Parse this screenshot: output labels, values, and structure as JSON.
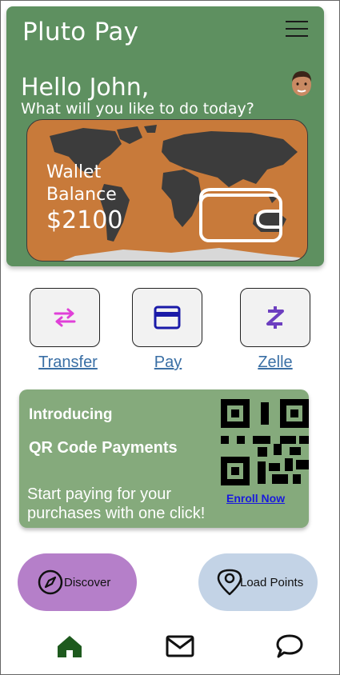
{
  "header": {
    "title": "Pluto Pay",
    "menu_icon": "hamburger-menu-icon",
    "avatar_icon": "user-avatar-icon"
  },
  "greeting": {
    "hello": "Hello John,",
    "question": "What will you like to do today?"
  },
  "wallet": {
    "label_line1": "Wallet",
    "label_line2": "Balance",
    "amount": "$2100",
    "icon": "wallet-icon"
  },
  "actions": [
    {
      "label": "Transfer",
      "icon": "transfer-arrows-icon",
      "icon_color": "#e040d8"
    },
    {
      "label": "Pay",
      "icon": "credit-card-icon",
      "icon_color": "#1a1aa8"
    },
    {
      "label": "Zelle",
      "icon": "zelle-logo-icon",
      "icon_color": "#6d3fc0"
    }
  ],
  "promo": {
    "line1": "Introducing",
    "line2": "QR Code Payments",
    "body": "Start paying for your purchases with one click!",
    "cta": "Enroll Now",
    "qr_icon": "qr-code-icon"
  },
  "pills": {
    "discover": {
      "label": "Discover",
      "icon": "compass-icon",
      "color": "#b57fc9"
    },
    "load_points": {
      "label": "Load Points",
      "icon": "location-pin-icon",
      "color": "#c3d3e6"
    }
  },
  "bottom_nav": [
    {
      "name": "home",
      "icon": "home-icon",
      "active_color": "#1e5a1e"
    },
    {
      "name": "messages",
      "icon": "mail-icon"
    },
    {
      "name": "chat",
      "icon": "chat-bubble-icon"
    }
  ],
  "colors": {
    "hero_bg": "#5e9060",
    "card_bg": "#c87a3a",
    "promo_bg": "#85aa7c",
    "link": "#3a6fa5"
  }
}
